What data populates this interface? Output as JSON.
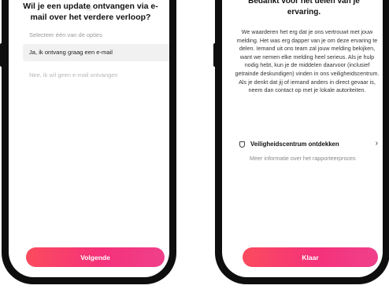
{
  "left_screen": {
    "question": "Wil je een update ontvangen via e-mail over het verdere verloop?",
    "hint": "Selecteer één van de opties",
    "option_selected": "Ja, ik ontvang graag een e-mail",
    "option_other": "Nee, ik wil geen e-mail ontvangen",
    "next_button": "Volgende"
  },
  "right_screen": {
    "title": "Bedankt voor het delen van je ervaring.",
    "body": "We waarderen het erg dat je ons vertrouwt met jouw melding. Het was erg dapper van je om deze ervaring te delen. Iemand uit ons team zal jouw melding bekijken, want we nemen elke melding heel serieus. Als je hulp nodig hebt, kun je de middelen daarvoor (inclusief getrainde deskundigen) vinden in ons veiligheidscentrum. Als je denkt dat jij of iemand anders in direct gevaar is, neem dan contact op met je lokale autoriteiten.",
    "link_label": "Veiligheidscentrum ontdekken",
    "link_sub": "Meer informatie over het rapporteerproces",
    "done_button": "Klaar"
  },
  "colors": {
    "accent": "#f5317a",
    "accent_start": "#fb4b5e"
  },
  "icons": {
    "shield": "shield-icon",
    "chevron": "chevron-right-icon"
  }
}
